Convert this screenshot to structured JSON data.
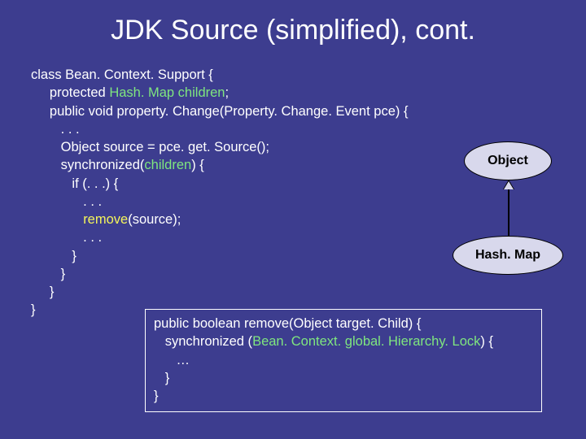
{
  "title": "JDK Source (simplified), cont.",
  "code": {
    "l1": "class Bean. Context. Support {",
    "l2": "     protected ",
    "l2_green": "Hash. Map children",
    "l2b": ";",
    "l3": "     public void property. Change(Property. Change. Event pce) {",
    "l4": "        . . .",
    "l5": "        Object source = pce. get. Source();",
    "l6": "        synchronized(",
    "l6_green": "children",
    "l6b": ") {",
    "l7": "           if (. . .) {",
    "l8": "              . . .",
    "l9": "              ",
    "l9_yellow": "remove",
    "l9b": "(source);",
    "l10": "              . . .",
    "l11": "           }",
    "l12": "        }",
    "l13": "     }",
    "l14": "}"
  },
  "bubbles": {
    "object": "Object",
    "hashmap": "Hash. Map"
  },
  "codebox": {
    "l1": "public boolean remove(Object target. Child) {",
    "l2": "   synchronized (",
    "l2_green": "Bean. Context. global. Hierarchy. Lock",
    "l2b": ") {",
    "l3": "      …",
    "l4": "   }",
    "l5": "}"
  }
}
